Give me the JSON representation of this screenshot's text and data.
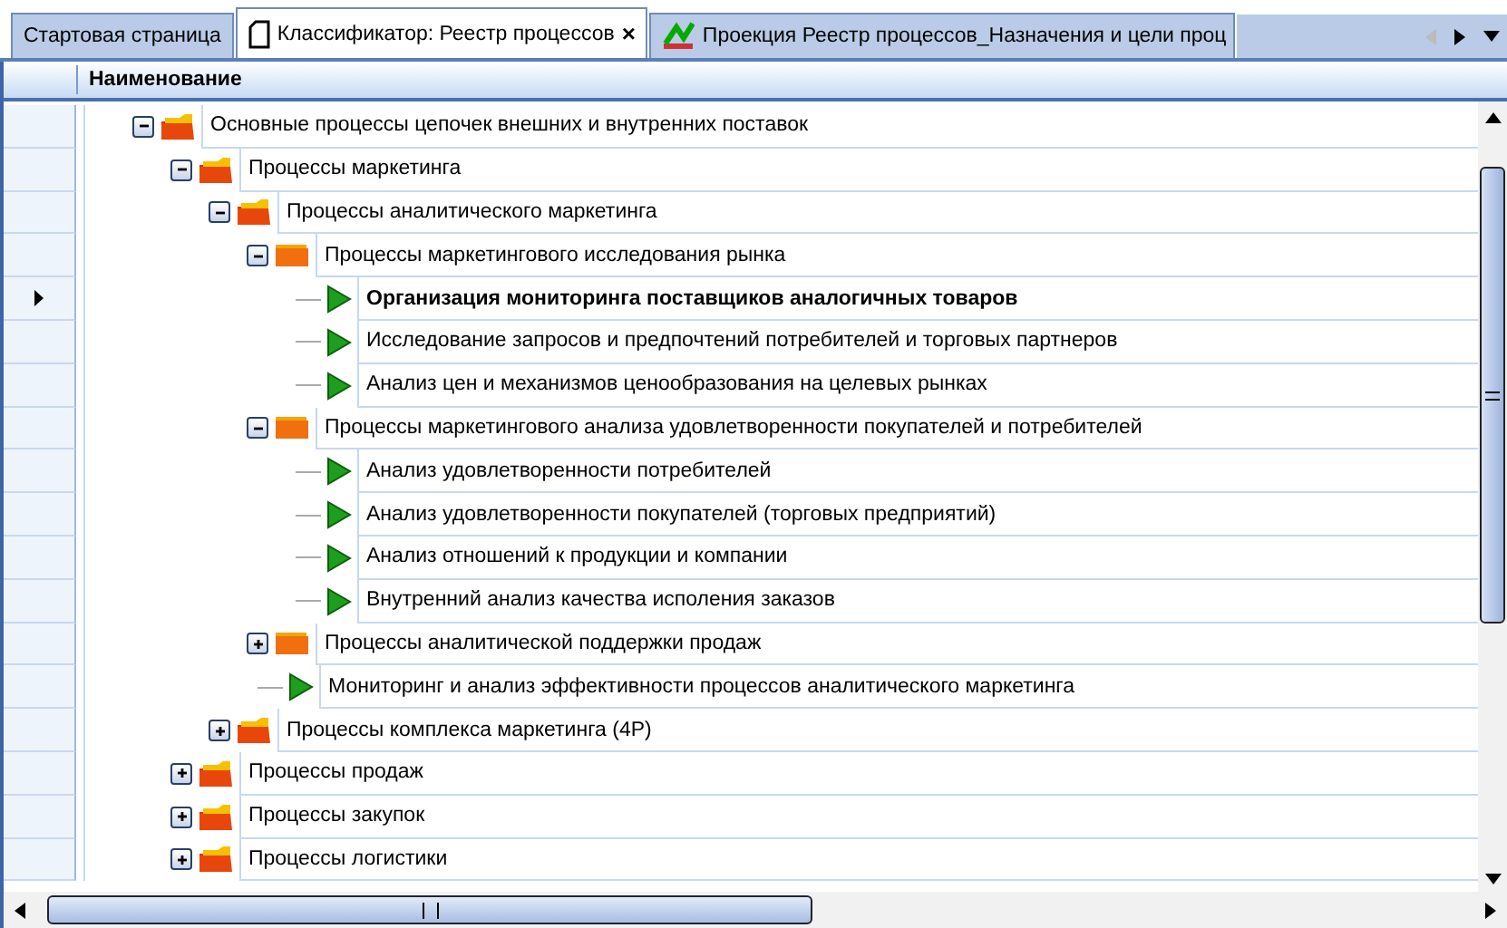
{
  "tabs": [
    {
      "label": "Стартовая страница",
      "selected": false
    },
    {
      "label": "Классификатор: Реестр процессов",
      "selected": true
    },
    {
      "label": "Проекция Реестр процессов_Назначения и цели проц",
      "selected": false
    }
  ],
  "tab_close": "×",
  "column_header": "Наименование",
  "tree": [
    {
      "label": "Основные процессы цепочек внешних и внутренних поставок",
      "kind": "folder",
      "expanded": true,
      "selected": false,
      "children": [
        {
          "label": "Процессы маркетинга",
          "kind": "folder",
          "expanded": true,
          "selected": false,
          "children": [
            {
              "label": "Процессы аналитического маркетинга",
              "kind": "folder",
              "expanded": true,
              "selected": false,
              "children": [
                {
                  "label": "Процессы маркетингового исследования рынка",
                  "kind": "group",
                  "expanded": true,
                  "selected": false,
                  "children": [
                    {
                      "label": "Организация мониторинга поставщиков аналогичных  товаров",
                      "kind": "process",
                      "selected": true
                    },
                    {
                      "label": "Исследование запросов и предпочтений потребителей и торговых партнеров",
                      "kind": "process",
                      "selected": false
                    },
                    {
                      "label": "Анализ цен и механизмов ценообразования на целевых рынках",
                      "kind": "process",
                      "selected": false
                    }
                  ]
                },
                {
                  "label": "Процессы маркетингового анализа удовлетворенности покупателей и потребителей",
                  "kind": "group",
                  "expanded": true,
                  "selected": false,
                  "children": [
                    {
                      "label": "Анализ удовлетворенности потребителей",
                      "kind": "process",
                      "selected": false
                    },
                    {
                      "label": "Анализ удовлетворенности покупателей (торговых предприятий)",
                      "kind": "process",
                      "selected": false
                    },
                    {
                      "label": "Анализ отношений к продукции и компании",
                      "kind": "process",
                      "selected": false
                    },
                    {
                      "label": "Внутренний анализ качества исполения заказов",
                      "kind": "process",
                      "selected": false
                    }
                  ]
                },
                {
                  "label": "Процессы аналитической поддержки продаж",
                  "kind": "group",
                  "expanded": false,
                  "selected": false
                },
                {
                  "label": "Мониторинг и анализ эффективности процессов аналитического маркетинга",
                  "kind": "process",
                  "selected": false
                }
              ]
            },
            {
              "label": "Процессы комплекса маркетинга (4P)",
              "kind": "folder",
              "expanded": false,
              "selected": false
            }
          ]
        },
        {
          "label": "Процессы продаж",
          "kind": "folder",
          "expanded": false,
          "selected": false
        },
        {
          "label": "Процессы закупок",
          "kind": "folder",
          "expanded": false,
          "selected": false
        },
        {
          "label": "Процессы логистики",
          "kind": "folder",
          "expanded": false,
          "selected": false
        }
      ]
    }
  ]
}
